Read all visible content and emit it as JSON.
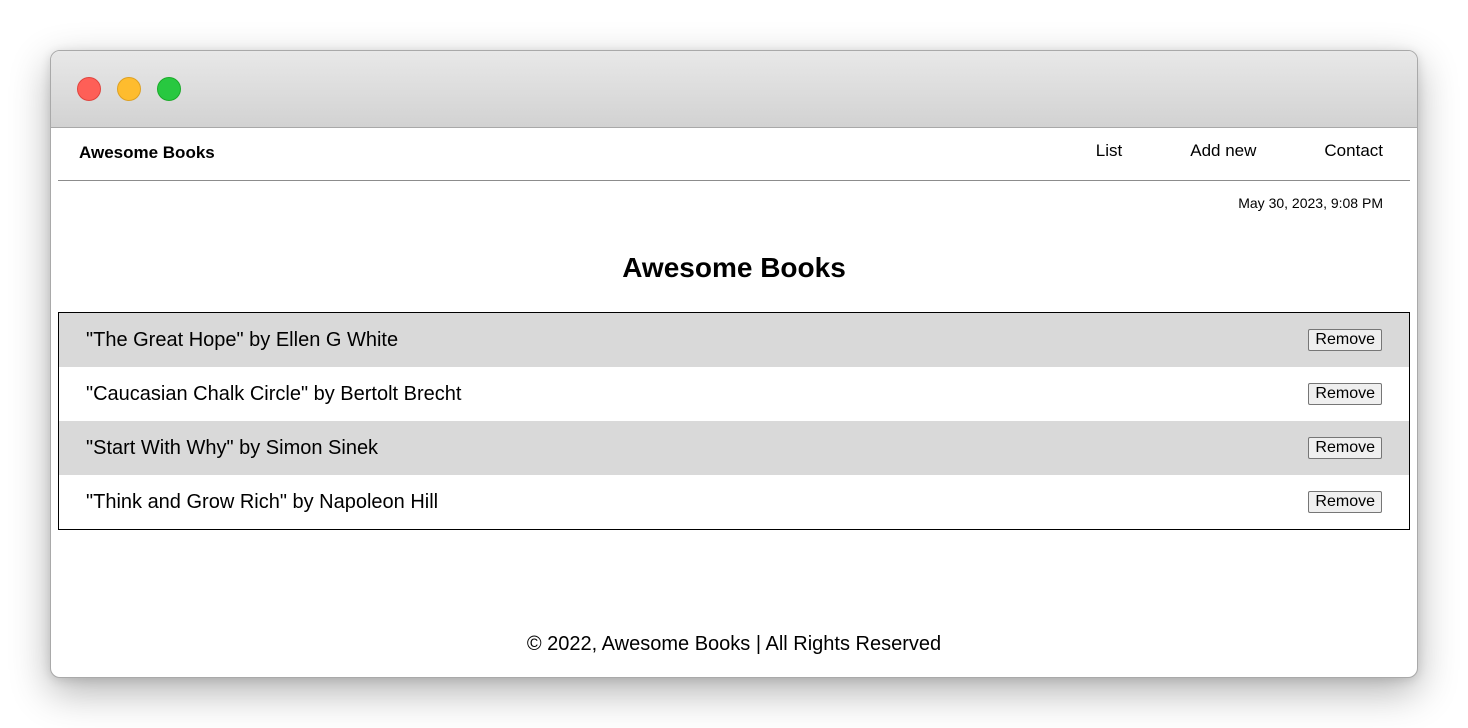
{
  "navbar": {
    "brand": "Awesome Books",
    "links": [
      "List",
      "Add new",
      "Contact"
    ]
  },
  "datetime": "May 30, 2023, 9:08 PM",
  "page_title": "Awesome Books",
  "books": [
    {
      "text": "\"The Great Hope\" by Ellen G White",
      "button": "Remove"
    },
    {
      "text": "\"Caucasian Chalk Circle\" by Bertolt Brecht",
      "button": "Remove"
    },
    {
      "text": "\"Start With Why\" by Simon Sinek",
      "button": "Remove"
    },
    {
      "text": "\"Think and Grow Rich\" by Napoleon Hill",
      "button": "Remove"
    }
  ],
  "footer": "© 2022, Awesome Books | All Rights Reserved",
  "colors": {
    "stripe": "#d9d9d9",
    "close": "#fe5f57",
    "minimize": "#febc2e",
    "maximize": "#28c840"
  }
}
